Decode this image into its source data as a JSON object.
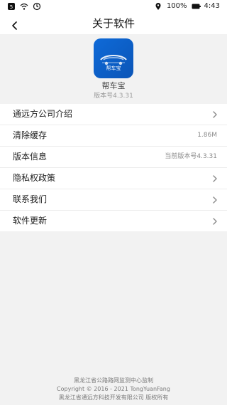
{
  "status_bar": {
    "battery_text": "100%",
    "time": "4:43"
  },
  "nav": {
    "title": "关于软件"
  },
  "app": {
    "icon_text": "帮车宝",
    "name": "帮车宝",
    "version": "版本号4.3.31"
  },
  "menu": {
    "items": [
      {
        "label": "通远方公司介绍",
        "value": ""
      },
      {
        "label": "清除缓存",
        "value": "1.86M"
      },
      {
        "label": "版本信息",
        "value": "当前版本号4.3.31"
      },
      {
        "label": "隐私权政策",
        "value": ""
      },
      {
        "label": "联系我们",
        "value": ""
      },
      {
        "label": "软件更新",
        "value": ""
      }
    ]
  },
  "footer": {
    "line1": "黑龙江省公路路网监测中心监制",
    "line2": "Copyright © 2016 - 2021 TongYuanFang",
    "line3": "黑龙江省通远方科技开发有限公司 版权所有"
  },
  "colors": {
    "accent_blue": "#0e6ad8",
    "background": "#f2f2f2",
    "divider": "#ececec"
  }
}
